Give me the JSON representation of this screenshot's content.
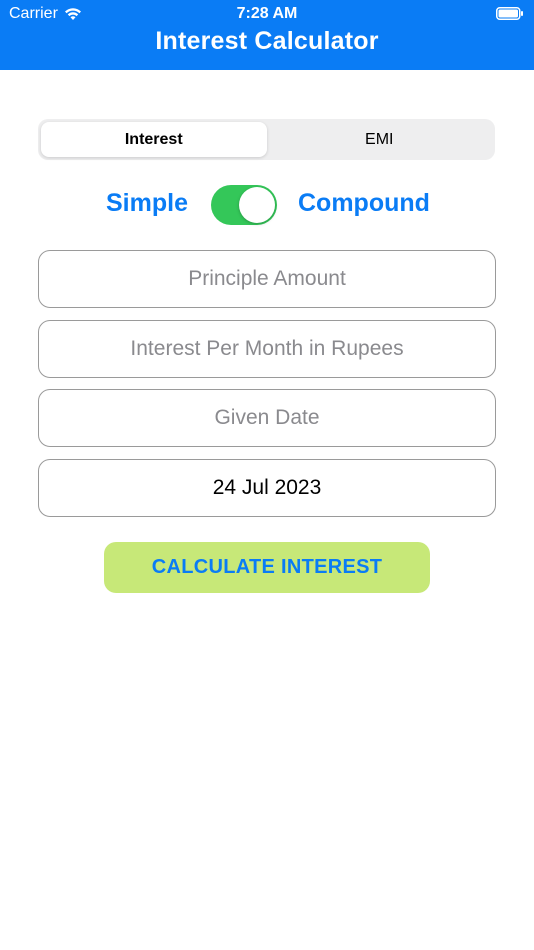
{
  "status": {
    "carrier": "Carrier",
    "time": "7:28 AM"
  },
  "header": {
    "title": "Interest Calculator"
  },
  "segments": [
    {
      "label": "Interest",
      "selected": true
    },
    {
      "label": "EMI",
      "selected": false
    }
  ],
  "toggle": {
    "left_label": "Simple",
    "right_label": "Compound",
    "on": true
  },
  "fields": {
    "principle_placeholder": "Principle Amount",
    "interest_placeholder": "Interest Per Month in Rupees",
    "given_date_placeholder": "Given Date",
    "current_date_value": "24 Jul 2023"
  },
  "button": {
    "label": "CALCULATE INTEREST"
  },
  "colors": {
    "header": "#0a7cf5",
    "accent": "#0a7cf5",
    "switch_on": "#34c759",
    "button_bg": "#c7e878"
  }
}
